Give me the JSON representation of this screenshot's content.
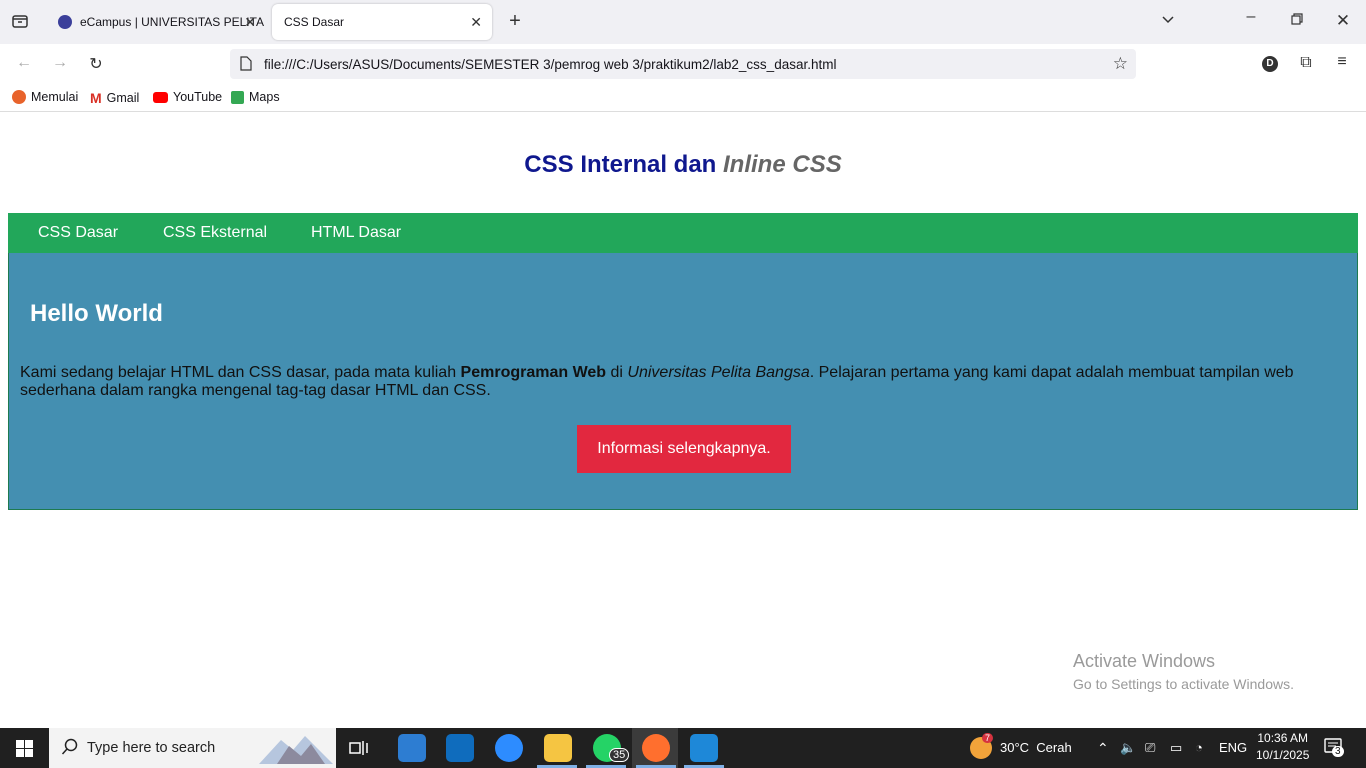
{
  "browser": {
    "tabs": [
      {
        "label": "eCampus | UNIVERSITAS PELITA"
      },
      {
        "label": "CSS Dasar"
      }
    ],
    "url": "file:///C:/Users/ASUS/Documents/SEMESTER 3/pemrog web 3/praktikum2/lab2_css_dasar.html",
    "account_initial": "D",
    "bookmarks": [
      "Memulai",
      "Gmail",
      "YouTube",
      "Maps"
    ]
  },
  "page": {
    "title_main": "CSS Internal dan",
    "title_em": "Inline CSS",
    "menu": [
      "CSS Dasar",
      "CSS Eksternal",
      "HTML Dasar"
    ],
    "heading": "Hello World",
    "para_1": "Kami sedang belajar HTML dan CSS dasar, pada mata kuliah ",
    "para_bold": "Pemrograman Web",
    "para_2": " di ",
    "para_italic": "Universitas Pelita Bangsa",
    "para_3": ". Pelajaran pertama yang kami dapat adalah membuat tampilan web sederhana dalam rangka mengenal tag-tag dasar HTML dan CSS.",
    "button": "Informasi selengkapnya."
  },
  "watermark": {
    "line1": "Activate Windows",
    "line2": "Go to Settings to activate Windows."
  },
  "taskbar": {
    "search_placeholder": "Type here to search",
    "whatsapp_badge": "35",
    "weather_badge": "7",
    "weather": "30°C  Cerah",
    "language": "ENG",
    "time": "10:36 AM",
    "date": "10/1/2025",
    "notification_count": "3"
  },
  "colors": {
    "title_blue": "#0f188e",
    "menu_green": "#22a75a",
    "content_blue": "#448fb1",
    "button_red": "#e2283f"
  }
}
